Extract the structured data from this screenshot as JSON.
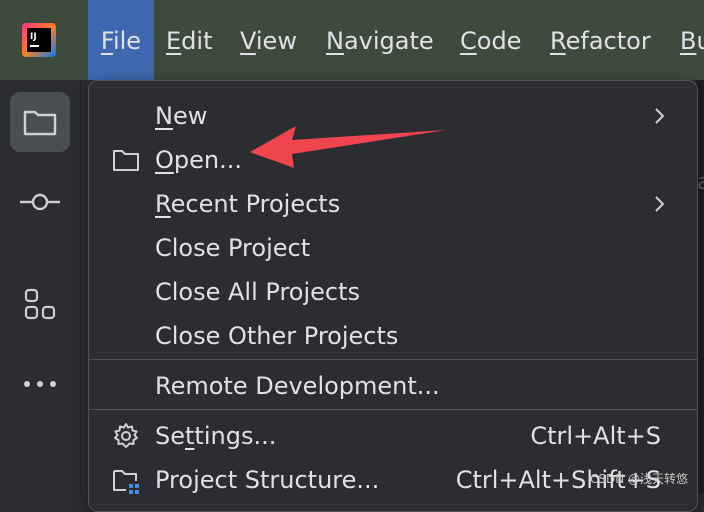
{
  "app": {
    "logo_text": "IJ"
  },
  "menubar": {
    "items": [
      {
        "label": "File",
        "mnemonic_index": 0,
        "active": true
      },
      {
        "label": "Edit",
        "mnemonic_index": 0
      },
      {
        "label": "View",
        "mnemonic_index": 0
      },
      {
        "label": "Navigate",
        "mnemonic_index": 0
      },
      {
        "label": "Code",
        "mnemonic_index": 0
      },
      {
        "label": "Refactor",
        "mnemonic_index": 0
      },
      {
        "label": "Bu",
        "mnemonic_index": 0
      }
    ]
  },
  "sidebar": {
    "buttons": [
      {
        "icon": "folder-icon",
        "active": true
      },
      {
        "icon": "commit-icon"
      },
      {
        "icon": "structure-icon"
      },
      {
        "icon": "more-icon"
      }
    ]
  },
  "editor": {
    "peek_char": "a"
  },
  "file_menu": {
    "items": [
      {
        "label": "New",
        "mnemonic": "N",
        "rest": "ew",
        "submenu": true
      },
      {
        "label": "Open...",
        "mnemonic": "O",
        "rest": "pen...",
        "icon": "folder-icon"
      },
      {
        "label": "Recent Projects",
        "mnemonic": "R",
        "rest": "ecent Projects",
        "submenu": true
      },
      {
        "label": "Close Project"
      },
      {
        "label": "Close All Projects"
      },
      {
        "label": "Close Other Projects"
      },
      {
        "label": "Remote Development..."
      },
      {
        "label": "Settings...",
        "pre": "Se",
        "mnemonic": "t",
        "rest": "tings...",
        "shortcut": "Ctrl+Alt+S",
        "icon": "gear-icon"
      },
      {
        "label": "Project Structure...",
        "shortcut": "Ctrl+Alt+Shift+S",
        "icon": "project-structure-icon"
      }
    ]
  },
  "annotation": {
    "arrow_color": "#f0444f"
  },
  "watermark": "CSDN @浅天转悠",
  "colors": {
    "menubar_bg": "#3d4a3c",
    "active_menu": "#3f68b0",
    "popup_bg": "#2b2d30",
    "text": "#dfe1e5"
  }
}
